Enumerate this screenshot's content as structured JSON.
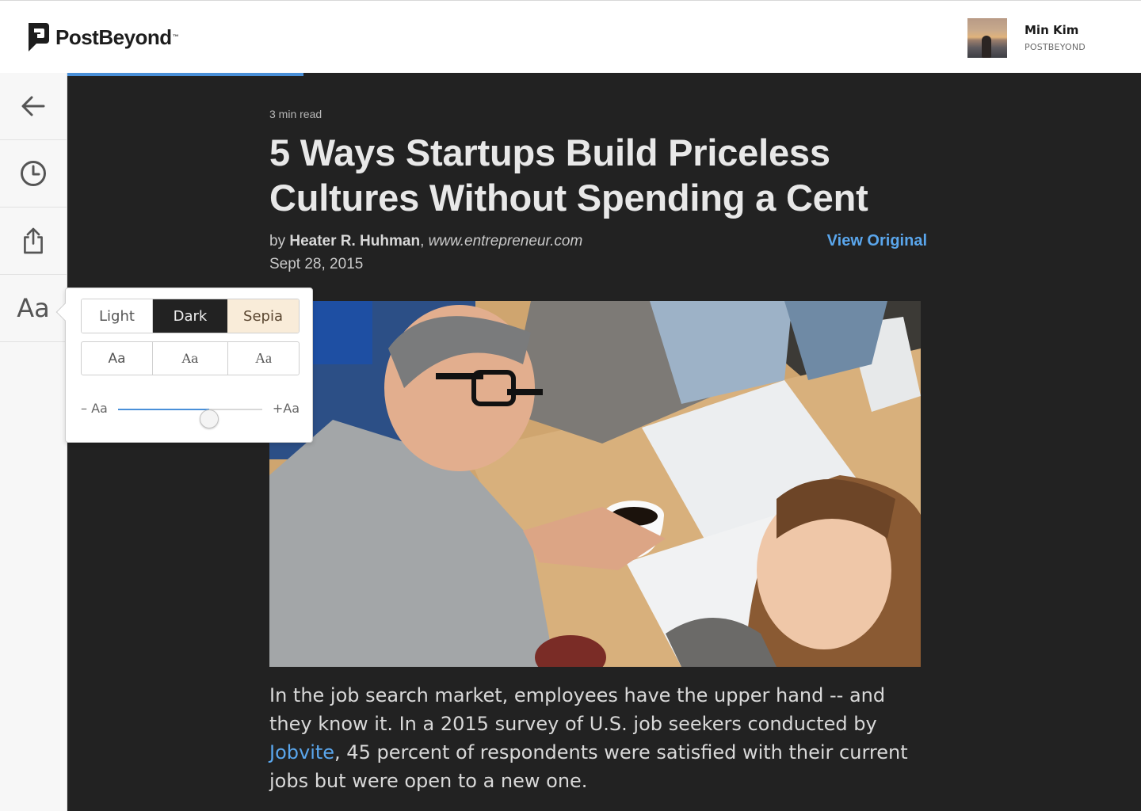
{
  "app": {
    "logo_text": "PostBeyond",
    "logo_tm": "™"
  },
  "user": {
    "name": "Min Kim",
    "org": "POSTBEYOND"
  },
  "reading_progress": 0.22,
  "sidebar": {
    "items": [
      {
        "name": "back",
        "icon": "arrow-left-icon"
      },
      {
        "name": "history",
        "icon": "clock-icon"
      },
      {
        "name": "share",
        "icon": "share-icon"
      },
      {
        "name": "text-settings",
        "label": "Aa"
      }
    ]
  },
  "article": {
    "read_time": "3 min read",
    "title": "5 Ways Startups Build Priceless Cultures Without Spending a Cent",
    "by_prefix": "by ",
    "author": "Heater R. Huhman",
    "separator": ", ",
    "source": "www.entrepreneur.com",
    "date": "Sept 28, 2015",
    "view_original": "View Original",
    "body_before_link": "In the job search market, employees have the upper hand -- and they know it. In a 2015 survey of U.S. job seekers conducted by ",
    "body_link": "Jobvite",
    "body_after_link": ", 45 percent of respondents were satisfied with their current jobs but were open to a new one."
  },
  "text_settings": {
    "themes": [
      "Light",
      "Dark",
      "Sepia"
    ],
    "selected_theme": "Dark",
    "fonts": [
      "Aa",
      "Aa",
      "Aa"
    ],
    "size_minus": "– Aa",
    "size_plus": "+Aa",
    "size_level": 0.63
  },
  "colors": {
    "accent": "#4a90d9",
    "link": "#5aa6ec",
    "dark_bg": "#222222",
    "sepia_bg": "#f9ecd9"
  }
}
